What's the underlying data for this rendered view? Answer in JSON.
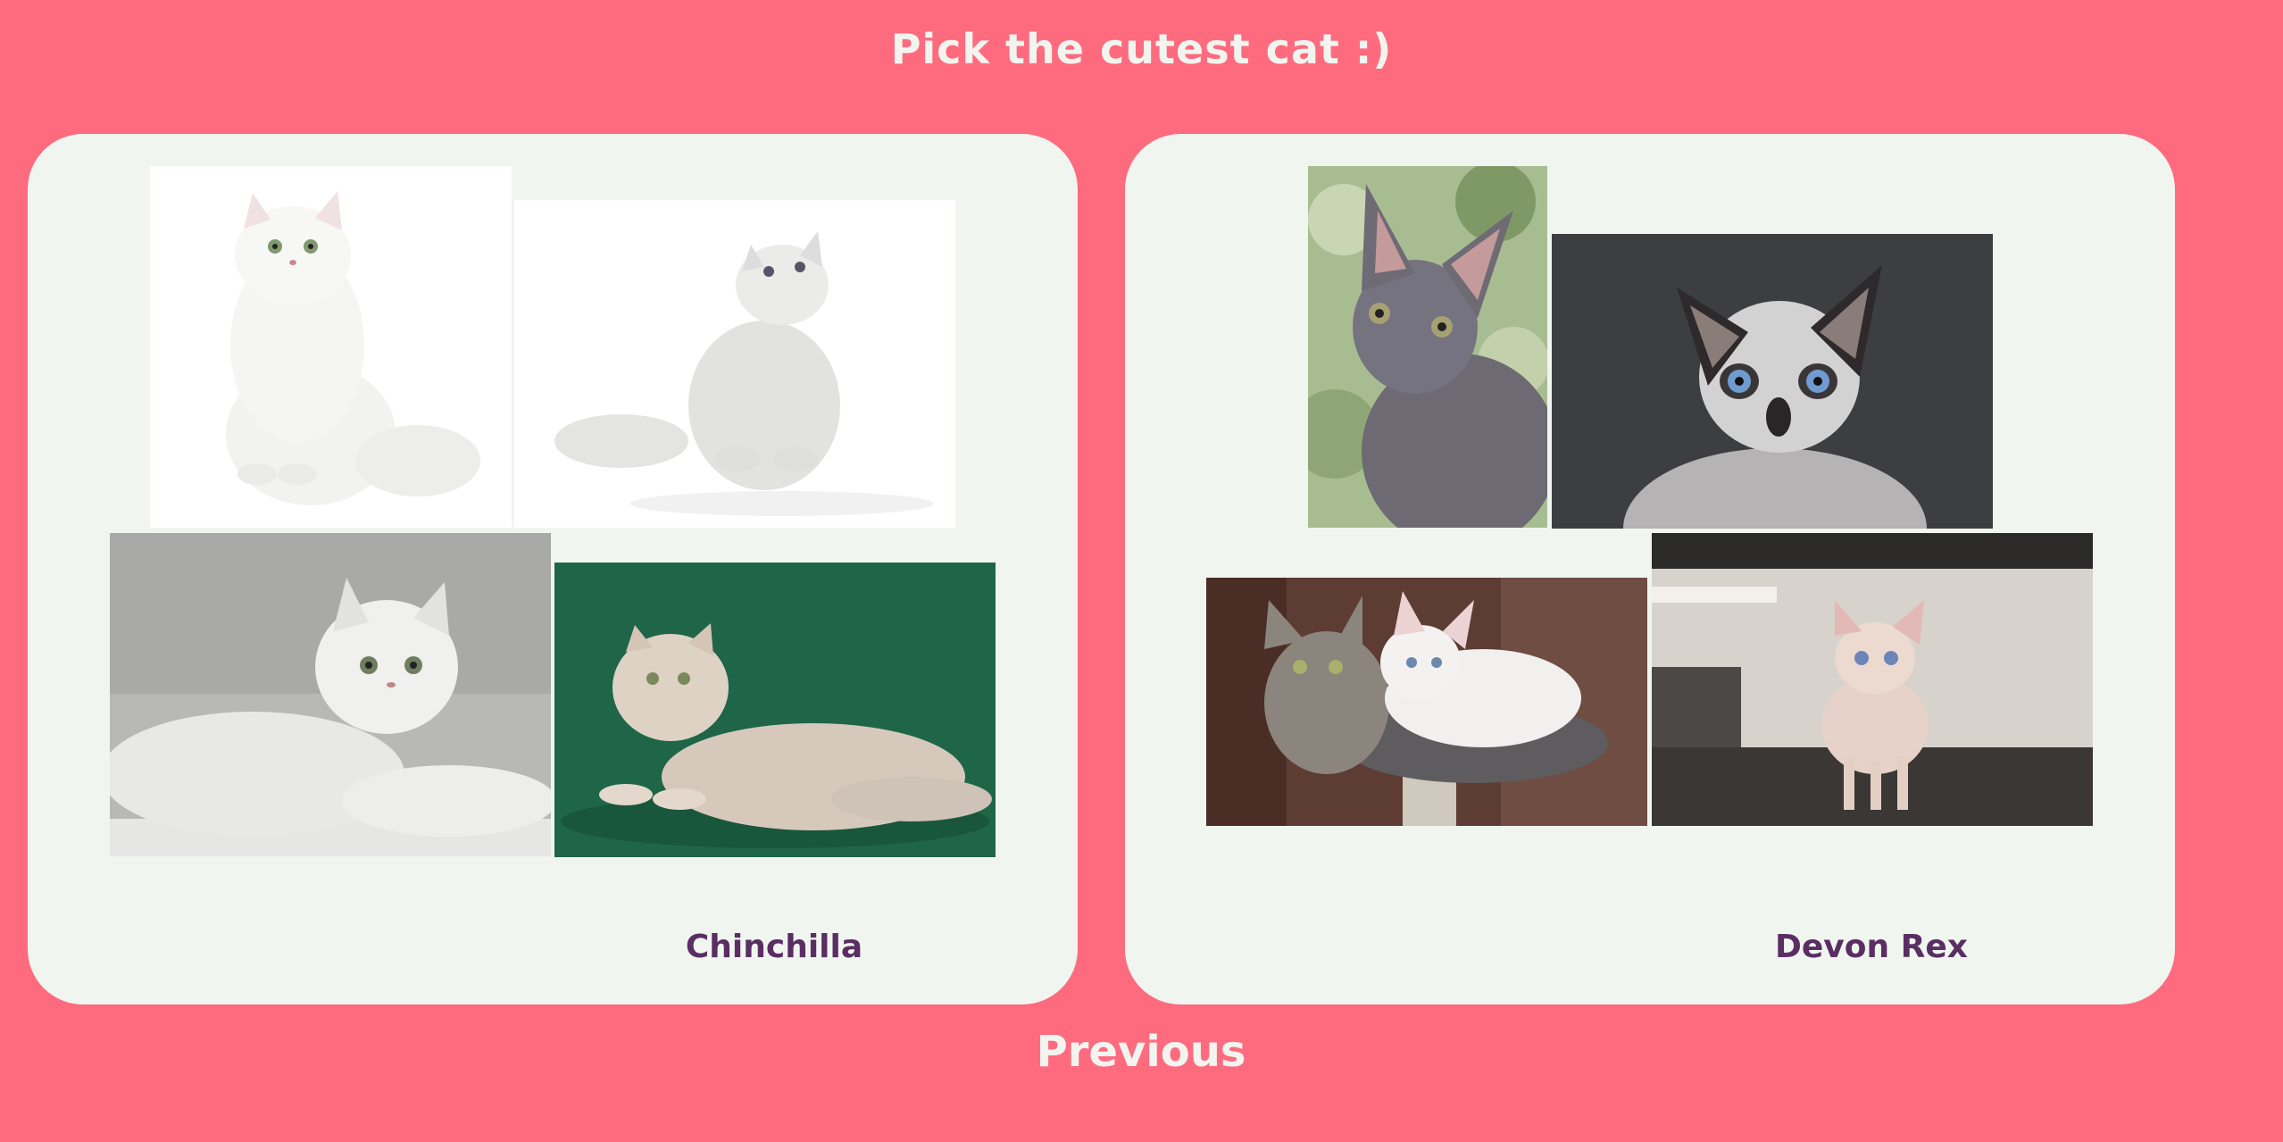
{
  "title": "Pick the cutest cat :)",
  "cards": [
    {
      "label": "Chinchilla",
      "photos": [
        {
          "name": "white persian cat sitting",
          "bg": "#FFFFFF",
          "fur": "#F4F4F2"
        },
        {
          "name": "silver persian looking up",
          "bg": "#FFFFFF",
          "fur": "#E6E6E4"
        },
        {
          "name": "silver chinchilla lying on blanket",
          "bg": "#B9B9B7",
          "fur": "#EEEEEC"
        },
        {
          "name": "cream persian on green background",
          "bg": "#1E6446",
          "fur": "#D8CBBF"
        }
      ]
    },
    {
      "label": "Devon Rex",
      "photos": [
        {
          "name": "grey devon rex by window",
          "bg": "#9DB48A",
          "fur": "#6E6B74"
        },
        {
          "name": "blue eyed devon rex portrait",
          "bg": "#3B3D3F",
          "fur": "#C9C9CB"
        },
        {
          "name": "two devon rex on cat tree",
          "bg": "#5B3B33",
          "fur": "#EFEDEB"
        },
        {
          "name": "pink devon rex kitten standing",
          "bg": "#D9D4CE",
          "fur": "#E8D2C8"
        }
      ]
    }
  ],
  "previous_label": "Previous"
}
